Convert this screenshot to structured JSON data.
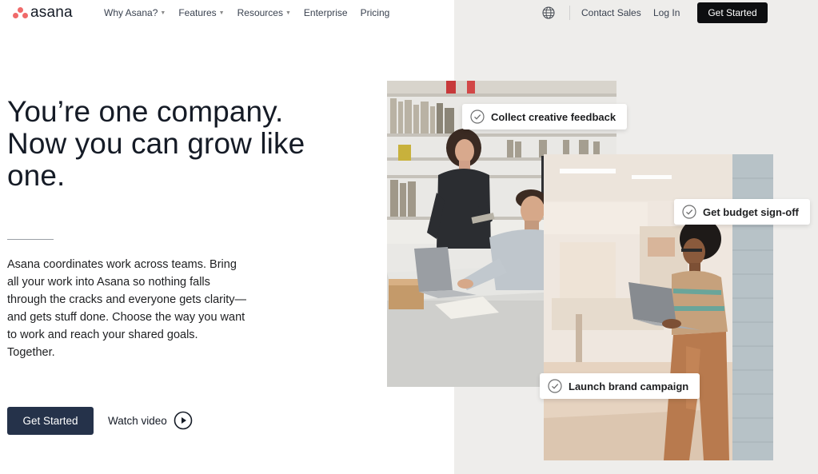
{
  "nav": {
    "brand": "asana",
    "links": [
      {
        "label": "Why Asana?",
        "dropdown": true
      },
      {
        "label": "Features",
        "dropdown": true
      },
      {
        "label": "Resources",
        "dropdown": true
      },
      {
        "label": "Enterprise",
        "dropdown": false
      },
      {
        "label": "Pricing",
        "dropdown": false
      }
    ],
    "language_icon": "globe-icon",
    "contact_sales": "Contact Sales",
    "login": "Log In",
    "cta": "Get Started"
  },
  "hero": {
    "headline": "You’re one company. Now you can grow like one.",
    "body": "Asana coordinates work across teams. Bring all your work into Asana so nothing falls through the cracks and everyone gets clarity—and gets stuff done. Choose the way you want to work and reach your shared goals. Together.",
    "cta": "Get Started",
    "watch_video": "Watch video"
  },
  "tasks": {
    "chip1": "Collect creative feedback",
    "chip2": "Get budget sign-off",
    "chip3": "Launch brand campaign"
  },
  "colors": {
    "brand_coral": "#f06a6a",
    "nav_cta_bg": "#0d0e10",
    "hero_cta_bg": "#25324a",
    "right_panel_bg": "#eeedeb"
  }
}
